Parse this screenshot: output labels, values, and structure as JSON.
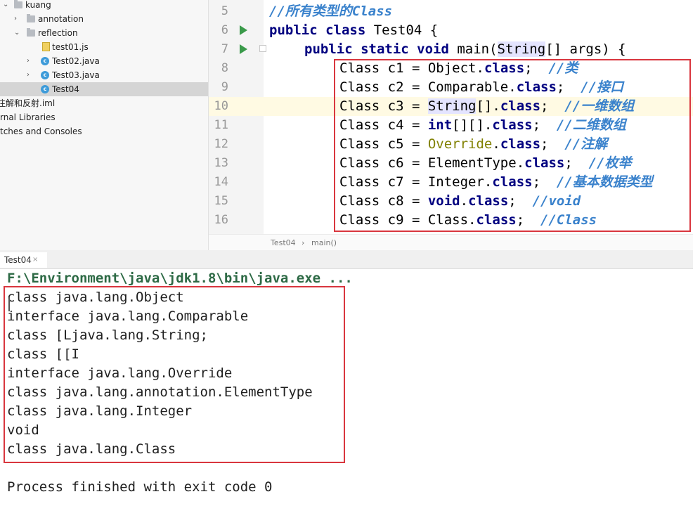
{
  "project_tree": {
    "items": [
      {
        "label": "kuang",
        "icon": "folder-icon",
        "expanded": true
      },
      {
        "label": "annotation",
        "icon": "folder-icon",
        "expanded": false
      },
      {
        "label": "reflection",
        "icon": "folder-icon",
        "expanded": true
      },
      {
        "label": "test01.js",
        "icon": "js-file-icon"
      },
      {
        "label": "Test02.java",
        "icon": "java-class-icon"
      },
      {
        "label": "Test03.java",
        "icon": "java-class-icon"
      },
      {
        "label": "Test04",
        "icon": "java-class-icon",
        "selected": true
      },
      {
        "label": "注解和反射.iml",
        "icon": "iml-file-icon"
      },
      {
        "label": "rnal Libraries",
        "icon": "library-icon"
      },
      {
        "label": "tches and Consoles",
        "icon": "scratch-icon"
      }
    ]
  },
  "editor": {
    "line_numbers": [
      "5",
      "6",
      "7",
      "8",
      "9",
      "10",
      "11",
      "12",
      "13",
      "14",
      "15",
      "16"
    ],
    "current_line": "10",
    "code": {
      "l5_comment": "//所有类型的Class",
      "l6_kw": "public class",
      "l6_rest": " Test04 {",
      "l7_kw": "public static void",
      "l7_main": " main(",
      "l7_string": "String",
      "l7_rest": "[] args) {",
      "rows": [
        {
          "prefix": "Class c1 = ",
          "type": "Object",
          "suffix": ".",
          "kw": "class",
          "end": ";  ",
          "comment": "//类"
        },
        {
          "prefix": "Class c2 = ",
          "type": "Comparable",
          "suffix": ".",
          "kw": "class",
          "end": ";  ",
          "comment": "//接口"
        },
        {
          "prefix": "Class c3 = ",
          "type": "String",
          "suffix": "[].",
          "kw": "class",
          "end": ";  ",
          "comment": "//一维数组"
        },
        {
          "prefix": "Class c4 = ",
          "type": "int",
          "suffix": "[][].",
          "kw": "class",
          "end": ";  ",
          "comment": "//二维数组"
        },
        {
          "prefix": "Class c5 = ",
          "type": "Override",
          "suffix": ".",
          "kw": "class",
          "end": ";  ",
          "comment": "//注解"
        },
        {
          "prefix": "Class c6 = ",
          "type": "ElementType",
          "suffix": ".",
          "kw": "class",
          "end": ";  ",
          "comment": "//枚举"
        },
        {
          "prefix": "Class c7 = ",
          "type": "Integer",
          "suffix": ".",
          "kw": "class",
          "end": ";  ",
          "comment": "//基本数据类型"
        },
        {
          "prefix": "Class c8 = ",
          "type": "void",
          "suffix": ".",
          "kw": "class",
          "end": ";  ",
          "comment": "//void"
        },
        {
          "prefix": "Class c9 = ",
          "type": "Class",
          "suffix": ".",
          "kw": "class",
          "end": ";  ",
          "comment": "//Class"
        }
      ]
    }
  },
  "breadcrumb": {
    "items": [
      "Test04",
      "main()"
    ],
    "separator": "›"
  },
  "run_window": {
    "tab_label": "Test04",
    "tab_close": "×",
    "command": "F:\\Environment\\java\\jdk1.8\\bin\\java.exe ...",
    "output": [
      "class java.lang.Object",
      "interface java.lang.Comparable",
      "class [Ljava.lang.String;",
      "class [[I",
      "interface java.lang.Override",
      "class java.lang.annotation.ElementType",
      "class java.lang.Integer",
      "void",
      "class java.lang.Class"
    ],
    "exit_message": "Process finished with exit code 0"
  },
  "colors": {
    "keyword": "#000080",
    "comment": "#3a82cc",
    "annotation": "#808000",
    "highlight_box": "#d9363e",
    "run_arrow": "#3a9a4a",
    "current_line": "#fffae3"
  }
}
